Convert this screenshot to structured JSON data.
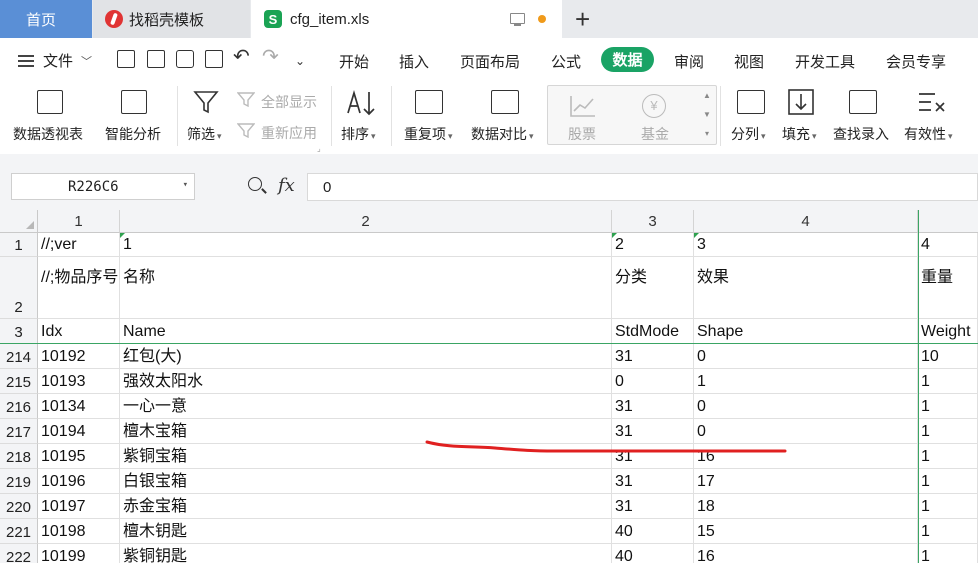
{
  "tabs": {
    "home": "首页",
    "template": "找稻壳模板",
    "file": "cfg_item.xls",
    "file_logo": "S",
    "add": "+"
  },
  "menu": {
    "file": "文件",
    "items": [
      "开始",
      "插入",
      "页面布局",
      "公式",
      "数据",
      "审阅",
      "视图",
      "开发工具",
      "会员专享"
    ],
    "active": "数据"
  },
  "ribbon": {
    "pivot": "数据透视表",
    "smart": "智能分析",
    "filter": "筛选",
    "show_all": "全部显示",
    "reapply": "重新应用",
    "sort": "排序",
    "dup": "重复项",
    "compare": "数据对比",
    "stock": "股票",
    "fund": "基金",
    "split": "分列",
    "fill": "填充",
    "lookup": "查找录入",
    "validity": "有效性"
  },
  "formula_bar": {
    "name_box": "R226C6",
    "fx": "fx",
    "value": "0"
  },
  "grid": {
    "col_headers": [
      "1",
      "2",
      "3",
      "4"
    ],
    "header_rows": [
      {
        "num": "1",
        "cells": [
          "//;ver",
          "1",
          "2",
          "3",
          "4"
        ]
      },
      {
        "num": "2",
        "cells": [
          "//;物品序号",
          "名称",
          "分类",
          "效果",
          "重量"
        ]
      },
      {
        "num": "3",
        "cells": [
          "Idx",
          "Name",
          "StdMode",
          "Shape",
          "Weight"
        ]
      }
    ],
    "rows": [
      {
        "num": "214",
        "cells": [
          "10192",
          "红包(大)",
          "31",
          "0",
          "10"
        ]
      },
      {
        "num": "215",
        "cells": [
          "10193",
          "强效太阳水",
          "0",
          "1",
          "1"
        ]
      },
      {
        "num": "216",
        "cells": [
          "10134",
          "一心一意",
          "31",
          "0",
          "1"
        ]
      },
      {
        "num": "217",
        "cells": [
          "10194",
          "檀木宝箱",
          "31",
          "0",
          "1"
        ]
      },
      {
        "num": "218",
        "cells": [
          "10195",
          "紫铜宝箱",
          "31",
          "16",
          "1"
        ]
      },
      {
        "num": "219",
        "cells": [
          "10196",
          "白银宝箱",
          "31",
          "17",
          "1"
        ]
      },
      {
        "num": "220",
        "cells": [
          "10197",
          "赤金宝箱",
          "31",
          "18",
          "1"
        ]
      },
      {
        "num": "221",
        "cells": [
          "10198",
          "檀木钥匙",
          "40",
          "15",
          "1"
        ]
      },
      {
        "num": "222",
        "cells": [
          "10199",
          "紫铜钥匙",
          "40",
          "16",
          "1"
        ]
      }
    ]
  },
  "colors": {
    "active_tab": "#5a8fd6",
    "brand_green": "#1aa365",
    "annotation_red": "#e02020"
  }
}
